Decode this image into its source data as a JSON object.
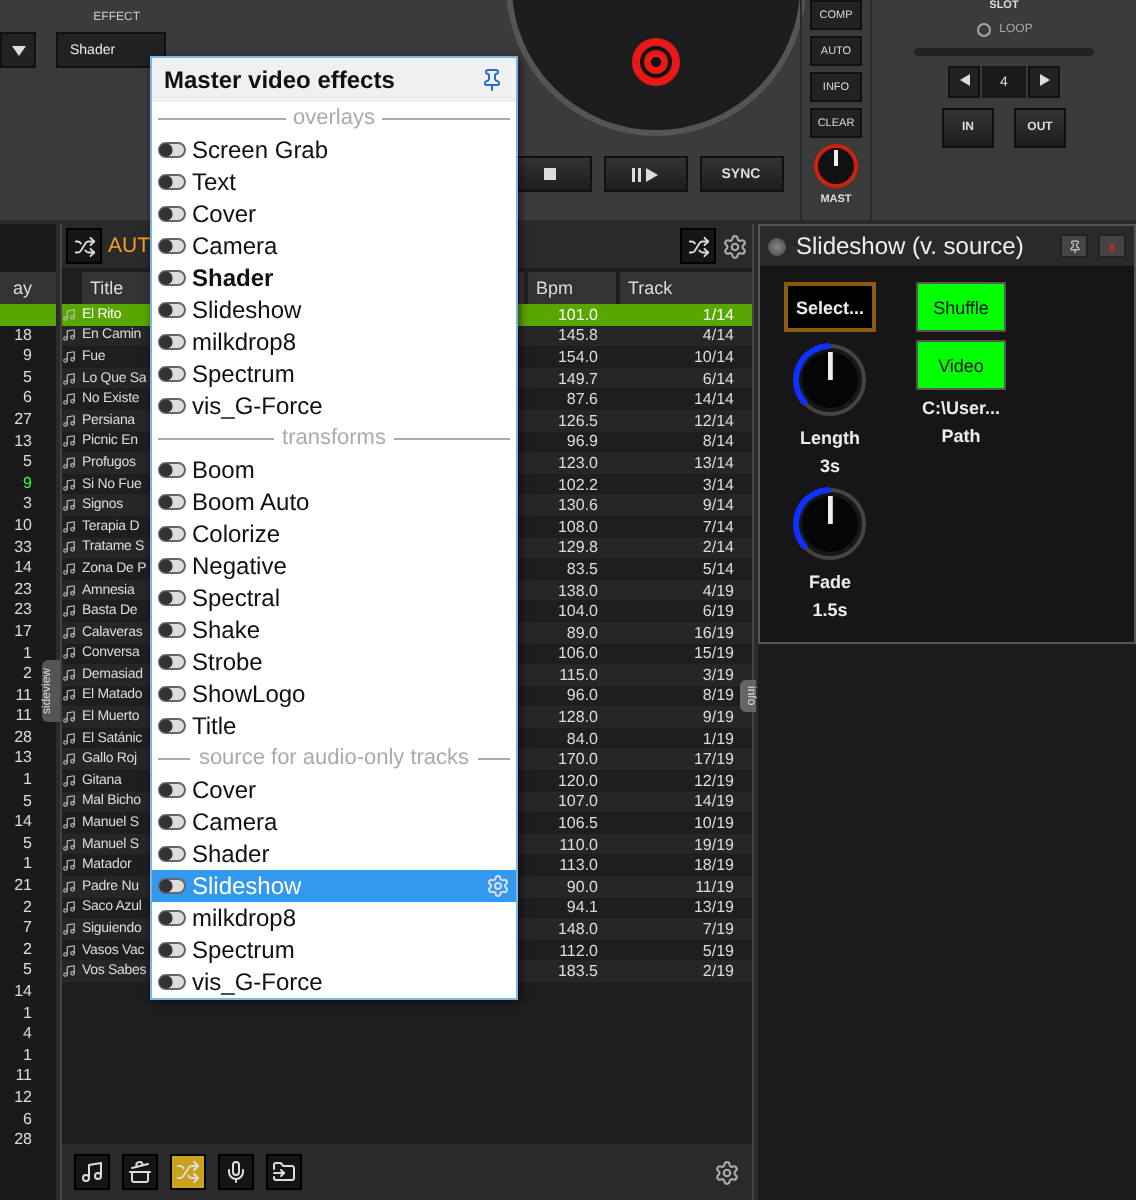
{
  "deck": {
    "effect_label": "EFFECT",
    "effect_select": "Shader",
    "side_buttons": [
      "COMP",
      "AUTO",
      "INFO",
      "CLEAR"
    ],
    "master_label": "MAST",
    "slot_label": "SLOT",
    "loop_label": "LOOP",
    "loop_value": "4",
    "loop_buttons": [
      "IN",
      "OUT"
    ],
    "transport": [
      {
        "kind": "stop"
      },
      {
        "kind": "play"
      },
      {
        "kind": "text",
        "label": "SYNC"
      }
    ]
  },
  "popup": {
    "title": "Master video effects",
    "sections": [
      {
        "heading": "overlays",
        "items": [
          {
            "label": "Screen Grab",
            "active": false,
            "selected": false
          },
          {
            "label": "Text",
            "active": false,
            "selected": false
          },
          {
            "label": "Cover",
            "active": false,
            "selected": false
          },
          {
            "label": "Camera",
            "active": false,
            "selected": false
          },
          {
            "label": "Shader",
            "active": true,
            "selected": false
          },
          {
            "label": "Slideshow",
            "active": false,
            "selected": false
          },
          {
            "label": "milkdrop8",
            "active": false,
            "selected": false
          },
          {
            "label": "Spectrum",
            "active": false,
            "selected": false
          },
          {
            "label": "vis_G-Force",
            "active": false,
            "selected": false
          }
        ]
      },
      {
        "heading": "transforms",
        "items": [
          {
            "label": "Boom",
            "active": false,
            "selected": false
          },
          {
            "label": "Boom Auto",
            "active": false,
            "selected": false
          },
          {
            "label": "Colorize",
            "active": false,
            "selected": false
          },
          {
            "label": "Negative",
            "active": false,
            "selected": false
          },
          {
            "label": "Spectral",
            "active": false,
            "selected": false
          },
          {
            "label": "Shake",
            "active": false,
            "selected": false
          },
          {
            "label": "Strobe",
            "active": false,
            "selected": false
          },
          {
            "label": "ShowLogo",
            "active": false,
            "selected": false
          },
          {
            "label": "Title",
            "active": false,
            "selected": false
          }
        ]
      },
      {
        "heading": "source for audio-only tracks",
        "items": [
          {
            "label": "Cover",
            "active": false,
            "selected": false
          },
          {
            "label": "Camera",
            "active": false,
            "selected": false
          },
          {
            "label": "Shader",
            "active": false,
            "selected": false
          },
          {
            "label": "Slideshow",
            "active": false,
            "selected": true
          },
          {
            "label": "milkdrop8",
            "active": false,
            "selected": false
          },
          {
            "label": "Spectrum",
            "active": false,
            "selected": false
          },
          {
            "label": "vis_G-Force",
            "active": false,
            "selected": false
          }
        ]
      }
    ]
  },
  "plays": {
    "header": "ay",
    "rows": [
      {
        "selected": true
      },
      {
        "value": "18",
        "selected": false
      },
      {
        "value": "9",
        "selected": false
      },
      {
        "value": "5",
        "selected": false
      },
      {
        "value": "6",
        "selected": false
      },
      {
        "value": "27",
        "selected": false
      },
      {
        "value": "13",
        "selected": false
      },
      {
        "value": "5",
        "selected": false
      },
      {
        "value": "9",
        "selected": true
      },
      {
        "value": "3",
        "selected": false
      },
      {
        "value": "10",
        "selected": false
      },
      {
        "value": "33",
        "selected": false
      },
      {
        "value": "14",
        "selected": false
      },
      {
        "value": "23",
        "selected": false
      },
      {
        "value": "23",
        "selected": false
      },
      {
        "value": "17",
        "selected": false
      },
      {
        "value": "1",
        "selected": false
      },
      {
        "value": "2",
        "selected": false
      },
      {
        "value": "11",
        "selected": false
      },
      {
        "value": "11",
        "selected": false
      },
      {
        "value": "28",
        "selected": false
      },
      {
        "value": "13",
        "selected": false
      },
      {
        "value": "1",
        "selected": false
      },
      {
        "value": "5",
        "selected": false
      },
      {
        "value": "14",
        "selected": false
      },
      {
        "value": "5",
        "selected": false
      },
      {
        "value": "1",
        "selected": false
      },
      {
        "value": "21",
        "selected": false
      },
      {
        "value": "2",
        "selected": false
      },
      {
        "value": "7",
        "selected": false
      },
      {
        "value": "2",
        "selected": false
      },
      {
        "value": "5",
        "selected": false
      },
      {
        "value": "14",
        "selected": false
      },
      {
        "value": "1",
        "selected": false
      },
      {
        "value": "4",
        "selected": false
      },
      {
        "value": "1",
        "selected": false
      },
      {
        "value": "11",
        "selected": false
      },
      {
        "value": "12",
        "selected": false
      },
      {
        "value": "6",
        "selected": false
      },
      {
        "value": "28",
        "selected": false
      }
    ]
  },
  "side_tabs": {
    "left": "sideview",
    "right": "info"
  },
  "browser": {
    "folder": "AUT",
    "columns": [
      "Title",
      "Bpm",
      "Track"
    ],
    "rows": [
      {
        "title": "El Rito",
        "bpm": "101.0",
        "track": "1/14",
        "selected": true
      },
      {
        "title": "En Camin",
        "bpm": "145.8",
        "track": "4/14",
        "selected": false
      },
      {
        "title": "Fue",
        "bpm": "154.0",
        "track": "10/14",
        "selected": false
      },
      {
        "title": "Lo Que Sa",
        "bpm": "149.7",
        "track": "6/14",
        "selected": false
      },
      {
        "title": "No Existe",
        "bpm": "87.6",
        "track": "14/14",
        "selected": false
      },
      {
        "title": "Persiana",
        "bpm": "126.5",
        "track": "12/14",
        "selected": false
      },
      {
        "title": "Picnic En",
        "bpm": "96.9",
        "track": "8/14",
        "selected": false
      },
      {
        "title": "Profugos",
        "bpm": "123.0",
        "track": "13/14",
        "selected": false
      },
      {
        "title": "Si No Fue",
        "bpm": "102.2",
        "track": "3/14",
        "selected": false
      },
      {
        "title": "Signos",
        "bpm": "130.6",
        "track": "9/14",
        "selected": false
      },
      {
        "title": "Terapia D",
        "bpm": "108.0",
        "track": "7/14",
        "selected": false
      },
      {
        "title": "Tratame S",
        "bpm": "129.8",
        "track": "2/14",
        "selected": false
      },
      {
        "title": "Zona De P",
        "bpm": "83.5",
        "track": "5/14",
        "selected": false
      },
      {
        "title": "Amnesia",
        "bpm": "138.0",
        "track": "4/19",
        "selected": false
      },
      {
        "title": "Basta De",
        "bpm": "104.0",
        "track": "6/19",
        "selected": false
      },
      {
        "title": "Calaveras",
        "bpm": "89.0",
        "track": "16/19",
        "selected": false
      },
      {
        "title": "Conversa",
        "bpm": "106.0",
        "track": "15/19",
        "selected": false
      },
      {
        "title": "Demasiad",
        "bpm": "115.0",
        "track": "3/19",
        "selected": false
      },
      {
        "title": "El Matado",
        "bpm": "96.0",
        "track": "8/19",
        "selected": false
      },
      {
        "title": "El Muerto",
        "bpm": "128.0",
        "track": "9/19",
        "selected": false
      },
      {
        "title": "El Satánic",
        "bpm": "84.0",
        "track": "1/19",
        "selected": false
      },
      {
        "title": "Gallo Roj",
        "bpm": "170.0",
        "track": "17/19",
        "selected": false
      },
      {
        "title": "Gitana",
        "bpm": "120.0",
        "track": "12/19",
        "selected": false
      },
      {
        "title": "Mal Bicho",
        "bpm": "107.0",
        "track": "14/19",
        "selected": false
      },
      {
        "title": "Manuel S",
        "bpm": "106.5",
        "track": "10/19",
        "selected": false
      },
      {
        "title": "Manuel S",
        "bpm": "110.0",
        "track": "19/19",
        "selected": false
      },
      {
        "title": "Matador",
        "bpm": "113.0",
        "track": "18/19",
        "selected": false
      },
      {
        "title": "Padre Nu",
        "bpm": "90.0",
        "track": "11/19",
        "selected": false
      },
      {
        "title": "Saco Azul",
        "bpm": "94.1",
        "track": "13/19",
        "selected": false
      },
      {
        "title": "Siguiendo",
        "bpm": "148.0",
        "track": "7/19",
        "selected": false
      },
      {
        "title": "Vasos Vac",
        "bpm": "112.0",
        "track": "5/19",
        "selected": false
      },
      {
        "title": "Vos Sabes",
        "bpm": "183.5",
        "track": "2/19",
        "selected": false
      }
    ],
    "tools": [
      {
        "kind": "music",
        "selected": false
      },
      {
        "kind": "pot",
        "selected": false
      },
      {
        "kind": "shuffle",
        "selected": true
      },
      {
        "kind": "mic",
        "selected": false
      },
      {
        "kind": "folder",
        "selected": false
      }
    ]
  },
  "effect_panel": {
    "title": "Slideshow (v. source)",
    "close": "x",
    "select_button": "Select...",
    "toggles": [
      {
        "label": "Shuffle",
        "on": true
      },
      {
        "label": "Video",
        "on": true
      }
    ],
    "path_value": "C:\\User...",
    "path_label": "Path",
    "knobs": [
      {
        "label": "Length",
        "value": "3s",
        "level": 0.5
      },
      {
        "label": "Fade",
        "value": "1.5s",
        "level": 0.5
      }
    ]
  }
}
